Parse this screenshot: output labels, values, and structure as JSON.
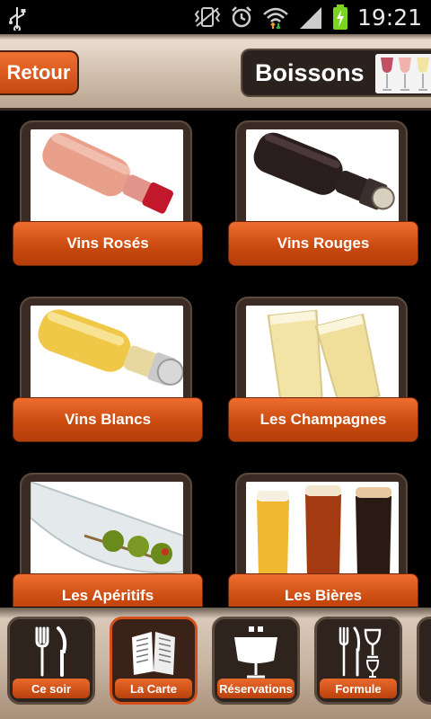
{
  "status_bar": {
    "time": "19:21",
    "icons": [
      "usb-icon",
      "vibrate-icon",
      "alarm-icon",
      "wifi-icon",
      "signal-icon",
      "battery-charging-icon"
    ]
  },
  "header": {
    "back_label": "Retour",
    "title": "Boissons"
  },
  "categories": [
    {
      "label": "Vins Rosés",
      "image": "rose-wine-bottle"
    },
    {
      "label": "Vins Rouges",
      "image": "red-wine-bottle"
    },
    {
      "label": "Vins Blancs",
      "image": "white-wine-bottle"
    },
    {
      "label": "Les Champagnes",
      "image": "champagne-glasses"
    },
    {
      "label": "Les Apéritifs",
      "image": "martini-olives"
    },
    {
      "label": "Les Bières",
      "image": "beer-glasses"
    }
  ],
  "bottom_nav": [
    {
      "label": "Ce soir",
      "icon": "fork-knife-icon"
    },
    {
      "label": "La Carte",
      "icon": "open-menu-book-icon",
      "active": true
    },
    {
      "label": "Réservations",
      "icon": "table-icon"
    },
    {
      "label": "Formule",
      "icon": "fork-knife-glass-icon"
    }
  ],
  "colors": {
    "accent_orange": "#d4501a",
    "dark_brown": "#2e231d",
    "header_beige": "#d8c8b7"
  }
}
